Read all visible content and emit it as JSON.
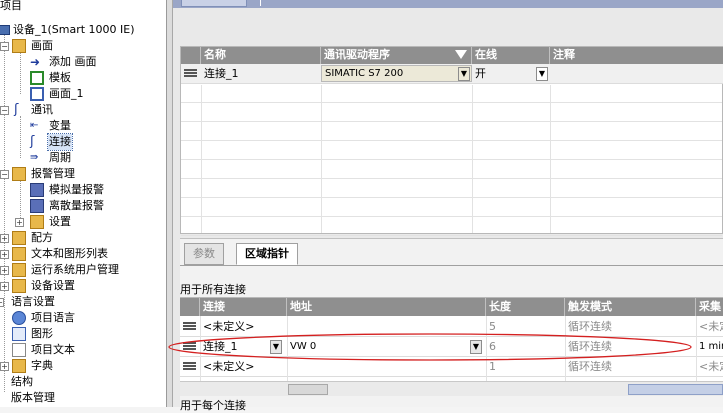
{
  "tree": {
    "items": [
      {
        "label": "项目"
      },
      {
        "label": "设备_1(Smart 1000 IE)"
      },
      {
        "label": "画面"
      },
      {
        "label": "添加 画面"
      },
      {
        "label": "模板"
      },
      {
        "label": "画面_1"
      },
      {
        "label": "通讯"
      },
      {
        "label": "变量"
      },
      {
        "label": "连接"
      },
      {
        "label": "周期"
      },
      {
        "label": "报警管理"
      },
      {
        "label": "模拟量报警"
      },
      {
        "label": "离散量报警"
      },
      {
        "label": "设置"
      },
      {
        "label": "配方"
      },
      {
        "label": "文本和图形列表"
      },
      {
        "label": "运行系统用户管理"
      },
      {
        "label": "设备设置"
      },
      {
        "label": "语言设置"
      },
      {
        "label": "项目语言"
      },
      {
        "label": "图形"
      },
      {
        "label": "项目文本"
      },
      {
        "label": "字典"
      },
      {
        "label": "结构"
      },
      {
        "label": "版本管理"
      }
    ]
  },
  "connections_table": {
    "headers": {
      "name": "名称",
      "driver": "通讯驱动程序",
      "online": "在线",
      "comment": "注释"
    },
    "rows": [
      {
        "name": "连接_1",
        "driver": "SIMATIC S7 200",
        "online": "开",
        "comment": ""
      }
    ]
  },
  "properties": {
    "tabs": {
      "params": "参数",
      "area_pointer": "区域指针"
    },
    "section_all": "用于所有连接",
    "section_each": "用于每个连接",
    "headers": {
      "connection": "连接",
      "address": "地址",
      "length": "长度",
      "trigger": "触发模式",
      "acq": "采集"
    },
    "rows": [
      {
        "connection": "<未定义>",
        "address": "",
        "length": "5",
        "trigger": "循环连续",
        "acq": "<未定"
      },
      {
        "connection": "连接_1",
        "address": "VW 0",
        "length": "6",
        "trigger": "循环连续",
        "acq": "1 min"
      },
      {
        "connection": "<未定义>",
        "address": "",
        "length": "1",
        "trigger": "循环连续",
        "acq": "<未定"
      }
    ]
  },
  "colors": {
    "header_gray": "#8f8f8f",
    "highlight_ellipse": "#d42020",
    "selected_row": "#f0f0f0",
    "driver_cell": "#ece9d8"
  }
}
